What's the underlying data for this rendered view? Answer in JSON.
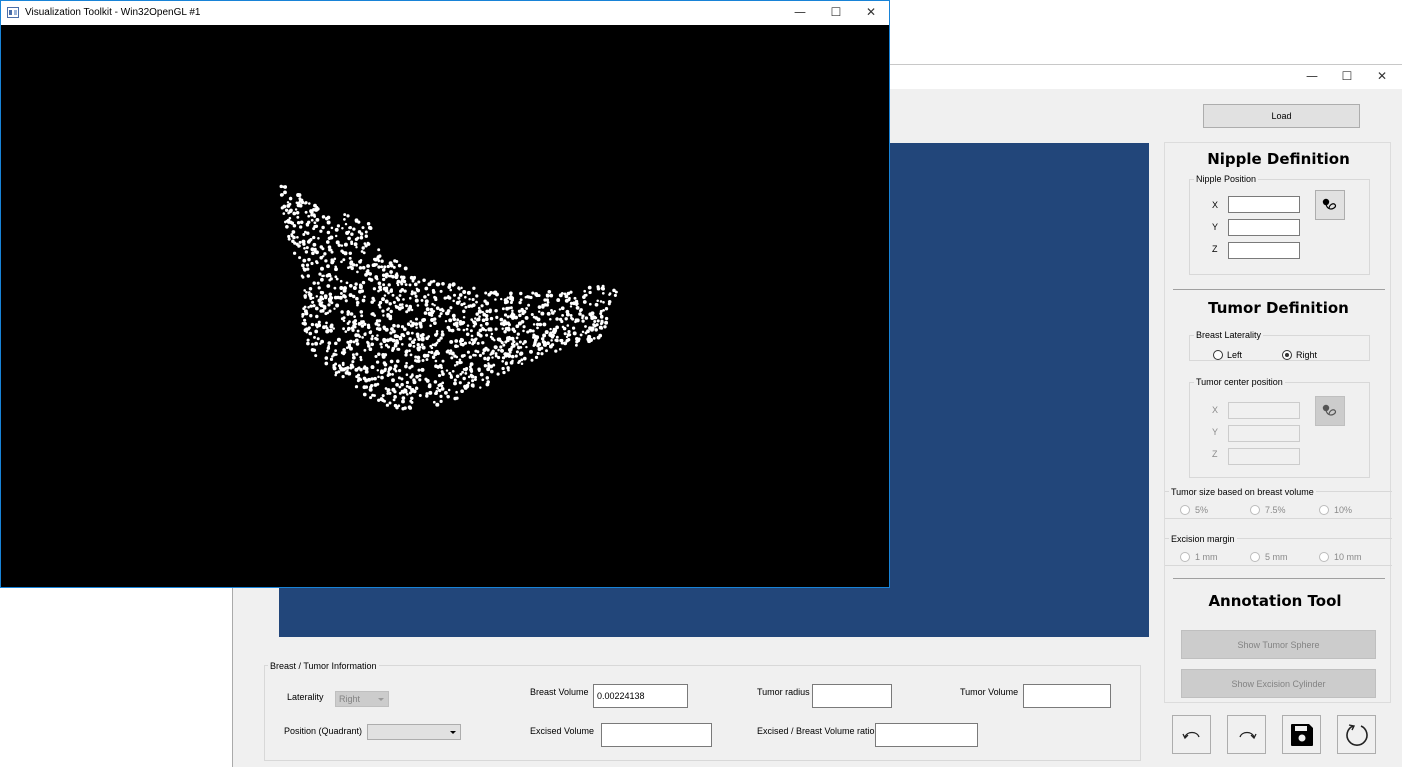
{
  "vtk_window": {
    "title": "Visualization Toolkit - Win32OpenGL #1",
    "controls": {
      "minimize": "—",
      "maximize": "☐",
      "close": "✕"
    }
  },
  "back_window": {
    "controls": {
      "minimize": "—",
      "maximize": "☐",
      "close": "✕"
    },
    "load_button": "Load"
  },
  "nipple": {
    "heading": "Nipple Definition",
    "group_title": "Nipple Position",
    "x_label": "X",
    "y_label": "Y",
    "z_label": "Z",
    "x_value": "",
    "y_value": "",
    "z_value": ""
  },
  "tumor": {
    "heading": "Tumor Definition",
    "laterality_title": "Breast Laterality",
    "left_label": "Left",
    "right_label": "Right",
    "selected": "Right",
    "center_title": "Tumor center position",
    "x_label": "X",
    "y_label": "Y",
    "z_label": "Z",
    "size_title": "Tumor size based on breast volume",
    "size_options": [
      "5%",
      "7.5%",
      "10%"
    ],
    "margin_title": "Excision margin",
    "margin_options": [
      "1 mm",
      "5 mm",
      "10 mm"
    ]
  },
  "annotation": {
    "heading": "Annotation Tool",
    "show_sphere": "Show Tumor Sphere",
    "show_cylinder": "Show Excision Cylinder"
  },
  "info": {
    "group_title": "Breast / Tumor Information",
    "laterality_label": "Laterality",
    "laterality_value": "Right",
    "position_label": "Position (Quadrant)",
    "position_value": "",
    "breast_volume_label": "Breast Volume",
    "breast_volume_value": "0.00224138",
    "tumor_radius_label": "Tumor radius",
    "tumor_radius_value": "",
    "tumor_volume_label": "Tumor Volume",
    "tumor_volume_value": "",
    "excised_volume_label": "Excised Volume",
    "excised_volume_value": "",
    "ratio_label": "Excised / Breast Volume ratio",
    "ratio_value": ""
  },
  "colors": {
    "viewport_blue": "#22467a",
    "canvas_black": "#000000",
    "point_cloud": "#ffffff"
  },
  "icons": [
    "undo-icon",
    "redo-icon",
    "save-icon",
    "reset-icon",
    "point-picker-icon"
  ]
}
